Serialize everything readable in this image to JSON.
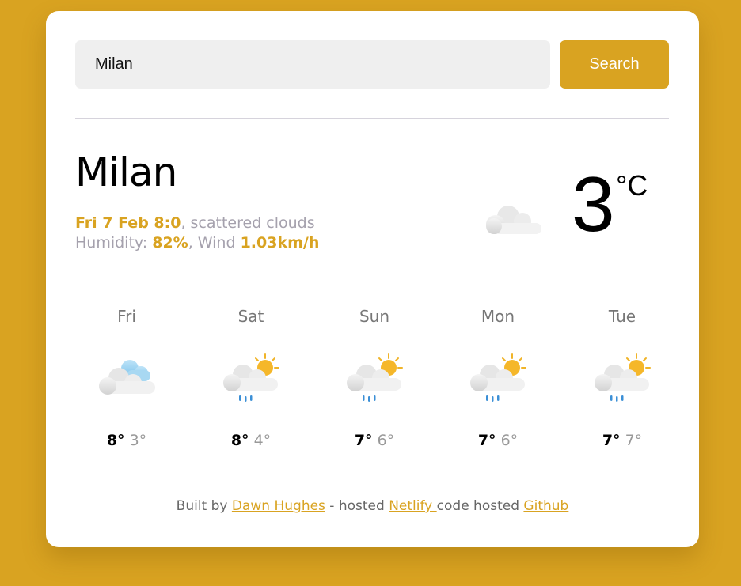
{
  "search": {
    "value": "Milan",
    "button_label": "Search"
  },
  "current": {
    "city": "Milan",
    "datetime": "Fri 7 Feb 8:0",
    "description": ", scattered clouds",
    "humidity_label": "Humidity: ",
    "humidity_value": "82%",
    "wind_label": ", Wind ",
    "wind_value": "1.03km/h",
    "temperature": "3",
    "unit": "°C",
    "icon": "scattered-clouds-icon"
  },
  "forecast": [
    {
      "day": "Fri",
      "max": "8°",
      "min": "3°",
      "icon": "broken-clouds-icon"
    },
    {
      "day": "Sat",
      "max": "8°",
      "min": "4°",
      "icon": "sun-rain-icon"
    },
    {
      "day": "Sun",
      "max": "7°",
      "min": "6°",
      "icon": "sun-rain-icon"
    },
    {
      "day": "Mon",
      "max": "7°",
      "min": "6°",
      "icon": "sun-rain-icon"
    },
    {
      "day": "Tue",
      "max": "7°",
      "min": "7°",
      "icon": "sun-rain-icon"
    }
  ],
  "footer": {
    "built_by": "Built by ",
    "author": "Dawn Hughes",
    "hosted": " - hosted ",
    "host": "Netlify ",
    "code_hosted": "code hosted ",
    "repo": "Github"
  },
  "colors": {
    "background": "#d9a321",
    "accent": "#d9a321",
    "card": "#ffffff",
    "input": "#efefef"
  }
}
